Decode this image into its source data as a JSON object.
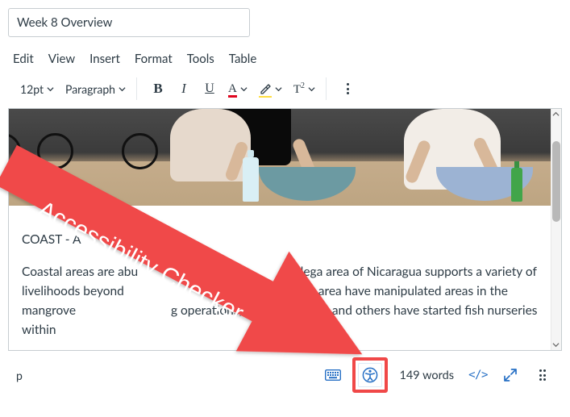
{
  "title_field": {
    "value": "Week 8 Overview"
  },
  "menubar": {
    "edit": "Edit",
    "view": "View",
    "insert": "Insert",
    "format": "Format",
    "tools": "Tools",
    "table": "Table"
  },
  "toolbar": {
    "font_size": "12pt",
    "block_format": "Paragraph",
    "bold_glyph": "B",
    "italic_glyph": "I",
    "underline_glyph": "U",
    "textcolor_glyph": "A",
    "super_glyph_base": "T",
    "super_glyph_exp": "2"
  },
  "content": {
    "caption_prefix": "COAST - A",
    "paragraph_pre": "Coastal areas are abu",
    "paragraph_mid1": "ndega area of Nicaragua supports a variety of livelihoods beyond",
    "paragraph_mid2": "People from the area have manipulated areas in the mangrove",
    "paragraph_mid3": "g operations, small and large, and others have started fish nurseries within"
  },
  "statusbar": {
    "path": "p",
    "word_count": "149 words",
    "html_label": "</>"
  },
  "annotation": {
    "label": "Accessibility Checker"
  }
}
